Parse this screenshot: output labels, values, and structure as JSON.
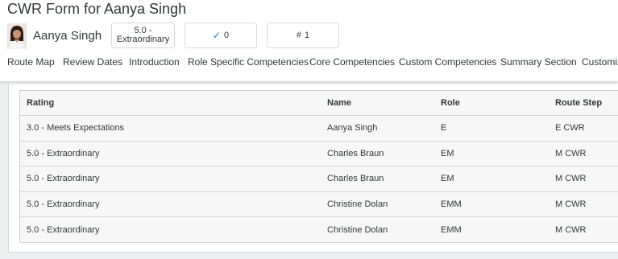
{
  "page": {
    "title": "CWR Form for Aanya Singh"
  },
  "employee": {
    "name": "Aanya Singh"
  },
  "tiles": {
    "rating": "5.0 -\nExtraordinary",
    "checks_count": "0",
    "rank": "1",
    "check_icon": "✓",
    "hash_icon": "#"
  },
  "tabs": [
    {
      "label": "Route Map"
    },
    {
      "label": "Review Dates"
    },
    {
      "label": "Introduction"
    },
    {
      "label": "Role Specific Competencies"
    },
    {
      "label": "Core Competencies"
    },
    {
      "label": "Custom Competencies"
    },
    {
      "label": "Summary Section"
    },
    {
      "label": "Customiz"
    }
  ],
  "table": {
    "headers": {
      "rating": "Rating",
      "name": "Name",
      "role": "Role",
      "route_step": "Route Step"
    },
    "rows": [
      {
        "rating": "3.0 - Meets Expectations",
        "name": "Aanya Singh",
        "role": "E",
        "route_step": "E CWR"
      },
      {
        "rating": "5.0 - Extraordinary",
        "name": "Charles Braun",
        "role": "EM",
        "route_step": "M CWR"
      },
      {
        "rating": "5.0 - Extraordinary",
        "name": "Charles Braun",
        "role": "EM",
        "route_step": "M CWR"
      },
      {
        "rating": "5.0 - Extraordinary",
        "name": "Christine Dolan",
        "role": "EMM",
        "route_step": "M CWR"
      },
      {
        "rating": "5.0 - Extraordinary",
        "name": "Christine Dolan",
        "role": "EMM",
        "route_step": "M CWR"
      }
    ]
  }
}
